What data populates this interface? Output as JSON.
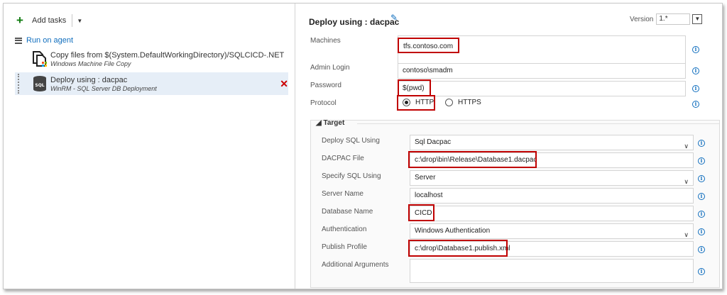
{
  "left": {
    "add_tasks_label": "Add tasks",
    "run_on_agent_label": "Run on agent",
    "tasks": [
      {
        "title": "Copy files from $(System.DefaultWorkingDirectory)/SQLCICD-.NET Deskt",
        "subtitle": "Windows Machine File Copy"
      },
      {
        "title": "Deploy using : dacpac",
        "subtitle": "WinRM - SQL Server DB Deployment",
        "icon_text": "SQL"
      }
    ]
  },
  "header": {
    "title": "Deploy using : dacpac",
    "version_label": "Version",
    "version_value": "1.*"
  },
  "fields": {
    "machines": {
      "label": "Machines",
      "value": "tfs.contoso.com"
    },
    "admin_login": {
      "label": "Admin Login",
      "value": "contoso\\smadm"
    },
    "password": {
      "label": "Password",
      "value": "$(pwd)"
    },
    "protocol": {
      "label": "Protocol",
      "options": [
        "HTTP",
        "HTTPS"
      ],
      "selected": "HTTP"
    }
  },
  "target": {
    "heading": "Target",
    "deploy_sql_using": {
      "label": "Deploy SQL Using",
      "value": "Sql Dacpac"
    },
    "dacpac_file": {
      "label": "DACPAC File",
      "value": "c:\\drop\\bin\\Release\\Database1.dacpac"
    },
    "specify_sql_using": {
      "label": "Specify SQL Using",
      "value": "Server"
    },
    "server_name": {
      "label": "Server Name",
      "value": "localhost"
    },
    "database_name": {
      "label": "Database Name",
      "value": "CICD"
    },
    "authentication": {
      "label": "Authentication",
      "value": "Windows Authentication"
    },
    "publish_profile": {
      "label": "Publish Profile",
      "value": "c:\\drop\\Database1.publish.xml"
    },
    "additional_arguments": {
      "label": "Additional Arguments",
      "value": ""
    }
  },
  "colors": {
    "accent": "#106ebe",
    "highlight": "#c00000",
    "add": "#107c10",
    "delete": "#cc0000"
  }
}
